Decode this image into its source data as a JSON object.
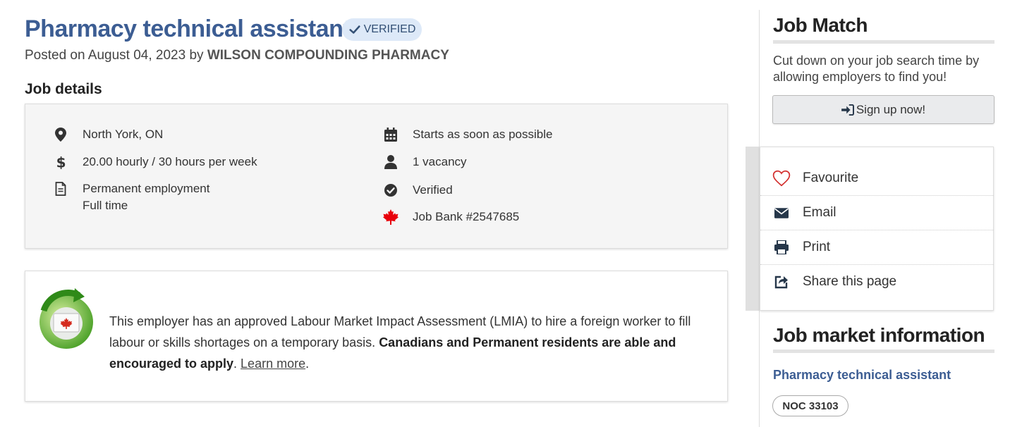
{
  "header": {
    "title": "Pharmacy technical assistant",
    "verified_badge": "VERIFIED",
    "posted_prefix": "Posted on August 04, 2023 by",
    "employer": "WILSON COMPOUNDING PHARMACY"
  },
  "job_details": {
    "title": "Job details",
    "location": "North York, ON",
    "salary": "20.00 hourly / 30 hours per week",
    "employment_type": "Permanent employment",
    "employment_schedule": "Full time",
    "start": "Starts as soon as possible",
    "vacancy": "1 vacancy",
    "verified": "Verified",
    "job_bank": "Job Bank #2547685"
  },
  "lmia": {
    "text_1": "This employer has an approved Labour Market Impact Assessment (LMIA) to hire a foreign worker to fill labour or skills shortages on a temporary basis. ",
    "text_bold": "Canadians and Permanent residents are able and encouraged to apply",
    "text_2": ". ",
    "link": "Learn more",
    "text_3": "."
  },
  "sidebar": {
    "job_match_title": "Job Match",
    "job_match_text": "Cut down on your job search time by allowing employers to find you!",
    "signup_label": "Sign up now!",
    "actions": {
      "favourite": "Favourite",
      "email": "Email",
      "print": "Print",
      "share": "Share this page"
    },
    "market_title": "Job market information",
    "market_link": "Pharmacy technical assistant",
    "noc": "NOC 33103"
  },
  "colors": {
    "title_blue": "#3c5d93",
    "badge_bg": "#dde9f8",
    "maple_red": "#e8000b",
    "heart_red": "#d3302f",
    "icon_navy": "#26374a"
  },
  "icons": {
    "location": "map-marker-icon",
    "salary": "dollar-icon",
    "employment": "document-icon",
    "start": "calendar-icon",
    "vacancy": "user-icon",
    "verified": "check-circle-icon",
    "job_bank": "maple-leaf-icon"
  }
}
